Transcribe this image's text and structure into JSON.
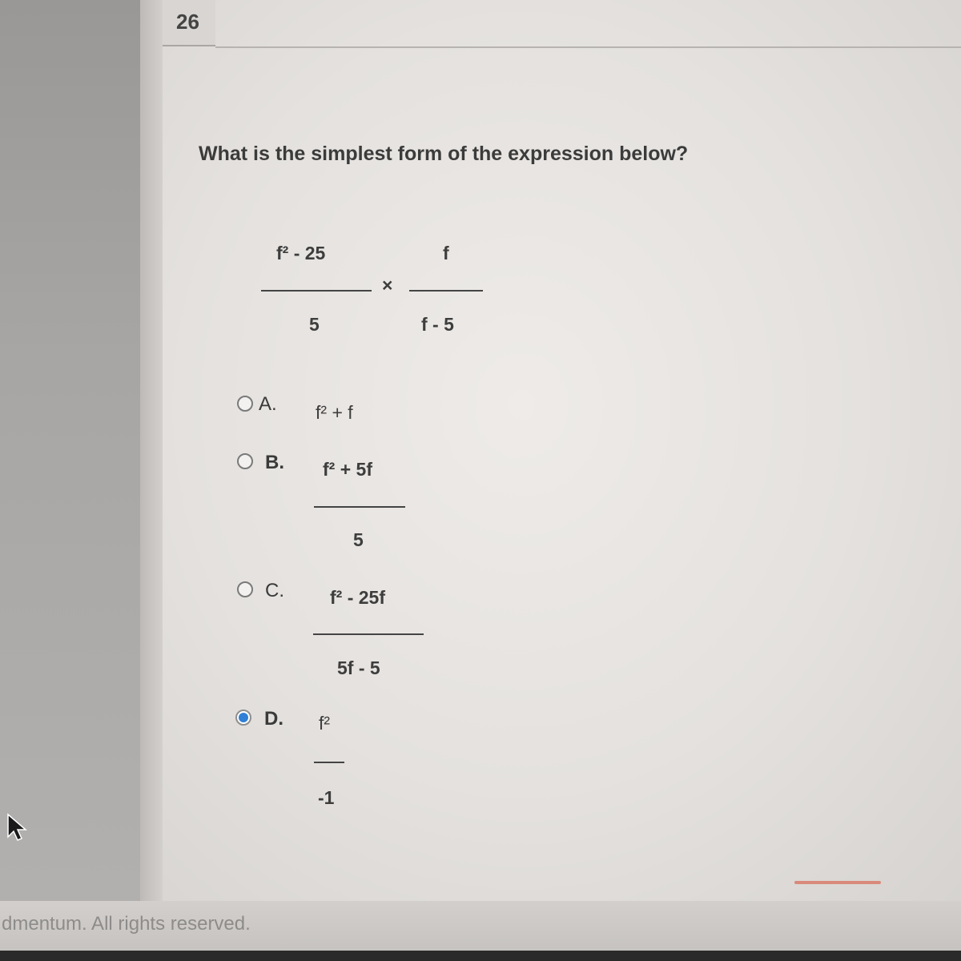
{
  "header": {
    "question_number": "26"
  },
  "question": {
    "text": "What is the simplest form of the expression below?",
    "expression": {
      "left_numerator": "f² - 25",
      "left_denominator": "5",
      "operator": "×",
      "right_numerator": "f",
      "right_denominator": "f - 5"
    }
  },
  "options": [
    {
      "letter": "A.",
      "numerator": "f² + f",
      "denominator": "",
      "selected": false
    },
    {
      "letter": "B.",
      "numerator": "f² + 5f",
      "denominator": "5",
      "selected": false
    },
    {
      "letter": "C.",
      "numerator": "f² - 25f",
      "denominator": "5f - 5",
      "selected": false
    },
    {
      "letter": "D.",
      "numerator": "f²",
      "denominator": "-1",
      "selected": true
    }
  ],
  "footer": {
    "text": "dmentum. All rights reserved."
  },
  "colors": {
    "selected_radio": "#2f7fd6",
    "accent_line": "#d98a7a"
  }
}
